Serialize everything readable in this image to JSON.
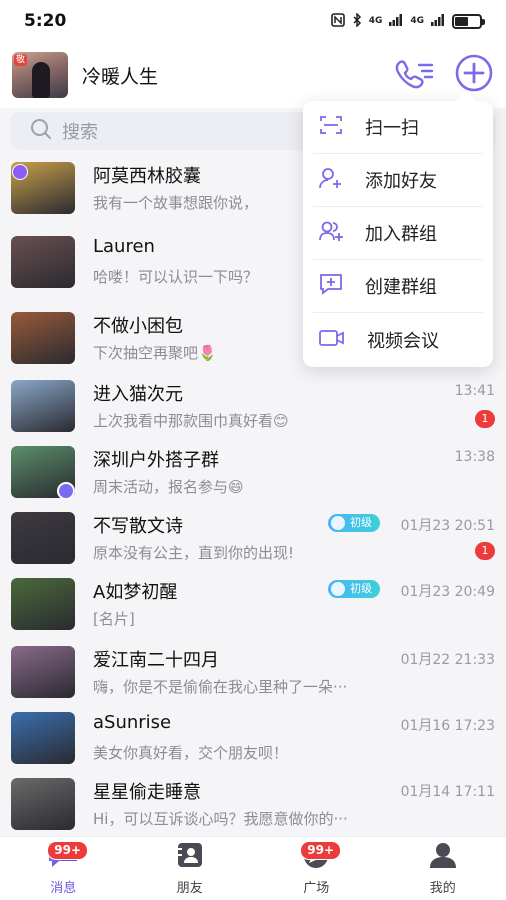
{
  "status": {
    "time": "5:20",
    "signal1": "4G",
    "signal2": "4G"
  },
  "header": {
    "title": "冷暖人生",
    "avatar_tag": "敬"
  },
  "search": {
    "placeholder": "搜索"
  },
  "menu": {
    "items": [
      {
        "label": "扫一扫",
        "icon": "scan-icon"
      },
      {
        "label": "添加好友",
        "icon": "add-friend-icon"
      },
      {
        "label": "加入群组",
        "icon": "join-group-icon"
      },
      {
        "label": "创建群组",
        "icon": "create-group-icon"
      },
      {
        "label": "视频会议",
        "icon": "video-meeting-icon"
      }
    ]
  },
  "chats": [
    {
      "name": "阿莫西林胶囊",
      "preview": "我有一个故事想跟你说，",
      "time": "",
      "unread": "",
      "level": "",
      "avatar_color": "#c9a04a"
    },
    {
      "name": "Lauren",
      "preview": "哈喽！可以认识一下吗？",
      "time": "",
      "unread": "",
      "level": "",
      "avatar_color": "#6a5050"
    },
    {
      "name": "不做小困包",
      "preview": "下次抽空再聚吧🌷",
      "time": "",
      "unread": "",
      "level": "",
      "avatar_color": "#9a5a3a"
    },
    {
      "name": "进入猫次元",
      "preview": "上次我看中那款围巾真好看😊",
      "time": "13:41",
      "unread": "1",
      "level": "",
      "avatar_color": "#8aa7c8"
    },
    {
      "name": "深圳户外搭子群",
      "preview": "周末活动，报名参与😄",
      "time": "13:38",
      "unread": "",
      "level": "",
      "avatar_color": "#5b8f6a"
    },
    {
      "name": "不写散文诗",
      "preview": "原本没有公主，直到你的出现!",
      "time": "01月23 20:51",
      "unread": "1",
      "level": "初级",
      "avatar_color": "#3d3a40"
    },
    {
      "name": "A如梦初醒",
      "preview": "[名片]",
      "time": "01月23 20:49",
      "unread": "",
      "level": "初级",
      "avatar_color": "#4a6a3a"
    },
    {
      "name": "爱江南二十四月",
      "preview": "嗨，你是不是偷偷在我心里种了一朵···",
      "time": "01月22 21:33",
      "unread": "",
      "level": "",
      "avatar_color": "#8a6a8a"
    },
    {
      "name": "aSunrise",
      "preview": "美女你真好看，交个朋友呗！",
      "time": "01月16 17:23",
      "unread": "",
      "level": "",
      "avatar_color": "#3a6fb0"
    },
    {
      "name": "星星偷走睡意",
      "preview": "Hi，可以互诉谈心吗？我愿意做你的···",
      "time": "01月14 17:11",
      "unread": "",
      "level": "",
      "avatar_color": "#6a6a6a"
    }
  ],
  "tabs": [
    {
      "label": "消息",
      "badge": "99+",
      "icon": "message-icon",
      "active": true
    },
    {
      "label": "朋友",
      "badge": "",
      "icon": "friends-icon",
      "active": false
    },
    {
      "label": "广场",
      "badge": "99+",
      "icon": "square-icon",
      "active": false
    },
    {
      "label": "我的",
      "badge": "",
      "icon": "profile-icon",
      "active": false
    }
  ],
  "colors": {
    "accent": "#6b5ae0",
    "unread": "#ec3b3b"
  },
  "battery_level": 0.55
}
